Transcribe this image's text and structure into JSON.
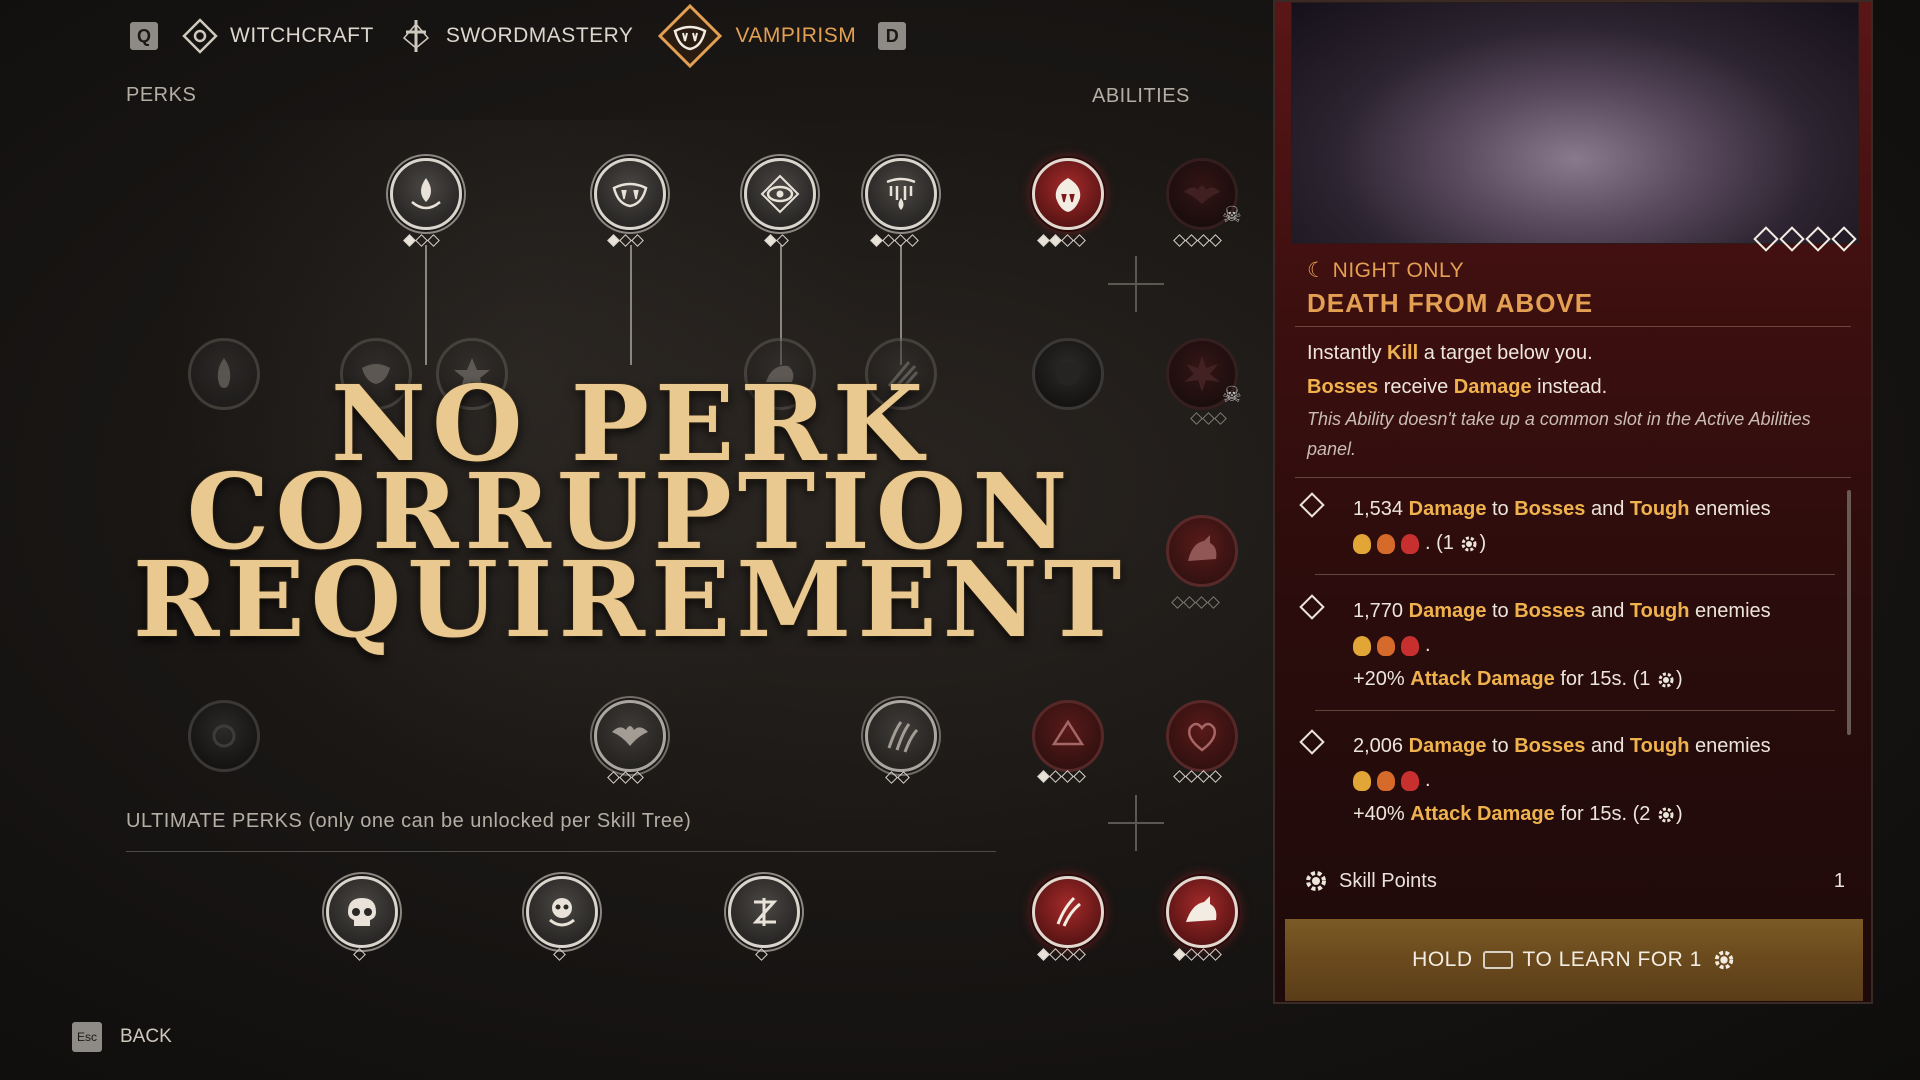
{
  "nav": {
    "prev_key": "Q",
    "next_key": "D",
    "tabs": [
      {
        "label": "WITCHCRAFT",
        "icon": "witchcraft-icon",
        "active": false
      },
      {
        "label": "SWORDMASTERY",
        "icon": "sword-icon",
        "active": false
      },
      {
        "label": "VAMPIRISM",
        "icon": "fangs-icon",
        "active": true
      }
    ]
  },
  "sections": {
    "perks": "PERKS",
    "abilities": "ABILITIES",
    "ultimate": "ULTIMATE PERKS (only one can be unlocked per Skill Tree)"
  },
  "overlay": {
    "line1": "NO PERK",
    "line2": "CORRUPTION",
    "line3": "REQUIREMENT"
  },
  "detail": {
    "tag": "☾ NIGHT ONLY",
    "title": "DEATH FROM ABOVE",
    "desc_line1_pre": "Instantly ",
    "desc_line1_hl": "Kill",
    "desc_line1_post": " a target below you.",
    "desc_line2_hl1": "Bosses",
    "desc_line2_mid": " receive ",
    "desc_line2_hl2": "Damage",
    "desc_line2_post": " instead.",
    "desc_note": "This Ability doesn't take up a common slot in the Active Abilities panel.",
    "tiers": [
      {
        "amount": "1,534",
        "extra": "",
        "extra_value": "",
        "extra_hl": "",
        "extra_post": "",
        "cost": "(1",
        "cost_end": ")"
      },
      {
        "amount": "1,770",
        "extra": "yes",
        "extra_value": "+20% ",
        "extra_hl": "Attack Damage",
        "extra_post": " for 15s.",
        "cost": "(1",
        "cost_end": ")"
      },
      {
        "amount": "2,006",
        "extra": "yes",
        "extra_value": "+40% ",
        "extra_hl": "Attack Damage",
        "extra_post": " for 15s.",
        "cost": "(2",
        "cost_end": ")"
      }
    ],
    "tier_text": {
      "damage": "Damage",
      "to": " to ",
      "bosses": "Bosses",
      "and": " and ",
      "tough": "Tough",
      "enemies": " enemies"
    },
    "skill_points_label": "Skill Points",
    "skill_points_value": "1",
    "learn_hold": "HOLD",
    "learn_text": "TO LEARN FOR 1"
  },
  "back": {
    "key": "Esc",
    "label": "BACK"
  },
  "colors": {
    "accent": "#e3a052",
    "panel_red": "#5a1616",
    "overlay_gold": "#e9c98f"
  }
}
